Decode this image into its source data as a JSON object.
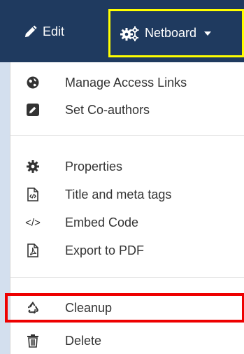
{
  "navbar": {
    "edit_label": "Edit",
    "netboard_label": "Netboard"
  },
  "menu": {
    "manage_access_links": "Manage Access Links",
    "set_coauthors": "Set Co-authors",
    "properties": "Properties",
    "title_meta_tags": "Title and meta tags",
    "embed_code": "Embed Code",
    "embed_code_icon": "</>",
    "export_pdf": "Export to PDF",
    "cleanup": "Cleanup",
    "delete": "Delete"
  },
  "colors": {
    "navbar": "#1f3a5f",
    "netboard_highlight": "#ffff00",
    "cleanup_highlight": "#ee0000",
    "left_strip": "#d3dfee"
  }
}
